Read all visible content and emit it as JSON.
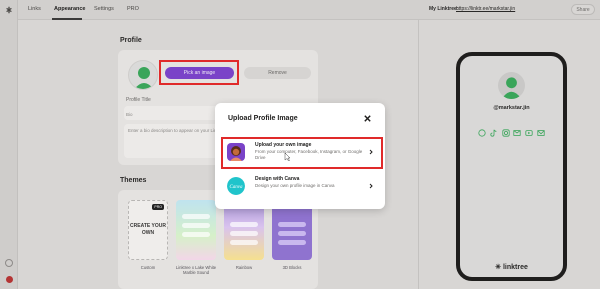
{
  "nav": {
    "tabs": [
      "Links",
      "Appearance",
      "Settings",
      "PRO"
    ],
    "active_tab": "Appearance",
    "linktree_label": "My Linktree:",
    "linktree_url": "https://linktr.ee/markstar.jin",
    "share_label": "Share"
  },
  "profile": {
    "section_title": "Profile",
    "pick_button": "Pick an image",
    "remove_button": "Remove",
    "profile_title_label": "Profile Title",
    "bio_label": "Bio",
    "bio_placeholder": "Enter a bio description to appear on your Linktree"
  },
  "themes": {
    "section_title": "Themes",
    "items": [
      {
        "label": "Custom",
        "tile_text": "CREATE YOUR OWN",
        "badge": "PRO"
      },
      {
        "label": "Linktree x Lake White Marble Sound",
        "tile_text": ""
      },
      {
        "label": "Rainbow",
        "tile_text": ""
      },
      {
        "label": "3D Blocks",
        "tile_text": ""
      }
    ]
  },
  "preview": {
    "handle": "@markstar.jin",
    "brand": "linktree",
    "social_icons": [
      "threads-icon",
      "tiktok-icon",
      "instagram-icon",
      "email-icon",
      "youtube-icon",
      "mail-icon"
    ]
  },
  "modal": {
    "title": "Upload Profile Image",
    "options": [
      {
        "title": "Upload your own image",
        "description": "From your computer, Facebook, Instagram, or Google Drive",
        "icon": "upload-photo-icon"
      },
      {
        "title": "Design with Canva",
        "description": "Design your own profile image in Canva",
        "icon": "canva-logo-icon"
      }
    ]
  },
  "colors": {
    "accent_purple": "#7a43c8",
    "highlight_red": "#e02a2a",
    "canva_teal": "#20c4cb",
    "avatar_green": "#3aa55a"
  }
}
